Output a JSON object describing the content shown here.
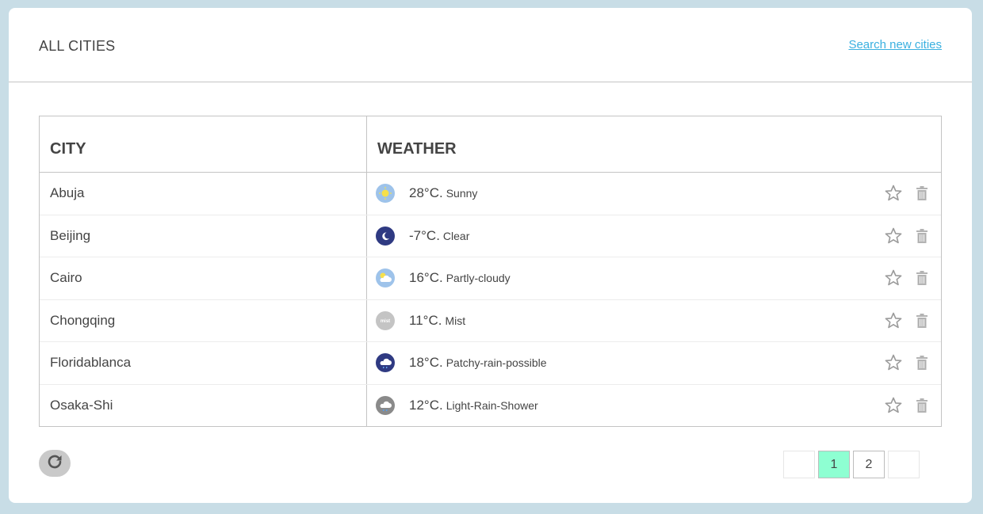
{
  "header": {
    "title": "ALL CITIES",
    "search_link": "Search new cities"
  },
  "table": {
    "columns": [
      "CITY",
      "WEATHER"
    ],
    "rows": [
      {
        "city": "Abuja",
        "temp": "28°C.",
        "condition": "Sunny",
        "icon": "sunny-icon"
      },
      {
        "city": "Beijing",
        "temp": "-7°C.",
        "condition": "Clear",
        "icon": "clear-night-icon"
      },
      {
        "city": "Cairo",
        "temp": "16°C.",
        "condition": "Partly-cloudy",
        "icon": "partly-cloudy-icon"
      },
      {
        "city": "Chongqing",
        "temp": "11°C.",
        "condition": "Mist",
        "icon": "mist-icon"
      },
      {
        "city": "Floridablanca",
        "temp": "18°C.",
        "condition": "Patchy-rain-possible",
        "icon": "patchy-rain-night-icon"
      },
      {
        "city": "Osaka-Shi",
        "temp": "12°C.",
        "condition": "Light-Rain-Shower",
        "icon": "light-rain-shower-icon"
      }
    ],
    "mist_icon_text": "mist"
  },
  "pagination": {
    "prev": "",
    "pages": [
      "1",
      "2"
    ],
    "active_page": "1",
    "next": ""
  },
  "colors": {
    "background": "#c8dde6",
    "link": "#3ab0e0",
    "active_page": "#8effd2",
    "icon_gray": "#b3b3b3"
  }
}
